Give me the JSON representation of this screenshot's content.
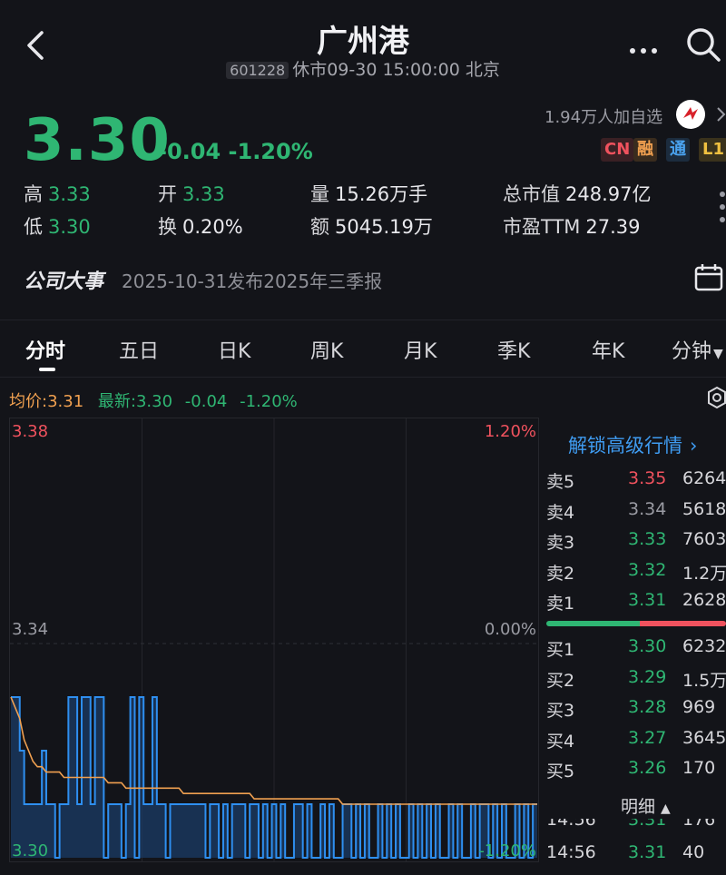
{
  "header": {
    "title": "广州港",
    "code": "601228",
    "status": "休市09-30 15:00:00 北京"
  },
  "quote": {
    "price": "3.30",
    "change": "-0.04 -1.20%",
    "watch_count": "1.94万人加自选",
    "badges": [
      "CN",
      "融",
      "通",
      "L1"
    ]
  },
  "stats": {
    "high_label": "高",
    "high": "3.33",
    "open_label": "开",
    "open": "3.33",
    "volume_label": "量",
    "volume": "15.26万手",
    "mcap_label": "总市值",
    "mcap": "248.97亿",
    "low_label": "低",
    "low": "3.30",
    "turnover_label": "换",
    "turnover": "0.20%",
    "amount_label": "额",
    "amount": "5045.19万",
    "pe_label": "市盈TTM",
    "pe": "27.39"
  },
  "event": {
    "label": "公司大事",
    "text": "2025-10-31发布2025年三季报"
  },
  "tabs": [
    "分时",
    "五日",
    "日K",
    "周K",
    "月K",
    "季K",
    "年K",
    "分钟"
  ],
  "chart_info": {
    "avg": "均价:3.31",
    "latest": "最新:3.30",
    "change": "-0.04",
    "pct": "-1.20%"
  },
  "chart_labels": {
    "y_top": "3.38",
    "y_mid": "3.34",
    "y_bot": "3.30",
    "pct_top": "1.20%",
    "pct_mid": "0.00%",
    "pct_bot": "-1.20%"
  },
  "chart_data": {
    "type": "line",
    "ylim": [
      3.3,
      3.38
    ],
    "series": [
      {
        "name": "价格",
        "color": "#2e8ff0",
        "values": [
          3.33,
          3.33,
          3.32,
          3.31,
          3.31,
          3.31,
          3.31,
          3.32,
          3.31,
          3.31,
          3.3,
          3.31,
          3.31,
          3.33,
          3.33,
          3.31,
          3.33,
          3.33,
          3.31,
          3.33,
          3.33,
          3.3,
          3.31,
          3.31,
          3.31,
          3.3,
          3.31,
          3.33,
          3.3,
          3.33,
          3.31,
          3.31,
          3.33,
          3.31,
          3.31,
          3.3,
          3.31,
          3.31,
          3.31,
          3.31,
          3.31,
          3.31,
          3.31,
          3.31,
          3.3,
          3.31,
          3.31,
          3.3,
          3.31,
          3.3,
          3.31,
          3.31,
          3.31,
          3.3,
          3.31,
          3.31,
          3.3,
          3.31,
          3.3,
          3.31,
          3.3,
          3.31,
          3.3,
          3.3,
          3.31,
          3.31,
          3.3,
          3.31,
          3.3,
          3.3,
          3.31,
          3.3,
          3.31,
          3.3,
          3.3,
          3.31,
          3.31,
          3.3,
          3.31,
          3.3,
          3.31,
          3.3,
          3.3,
          3.31,
          3.3,
          3.31,
          3.3,
          3.31,
          3.3,
          3.3,
          3.31,
          3.3,
          3.31,
          3.3,
          3.31,
          3.3,
          3.31,
          3.3,
          3.3,
          3.31,
          3.3,
          3.31,
          3.3,
          3.3,
          3.31,
          3.3,
          3.31,
          3.31,
          3.3,
          3.31,
          3.3,
          3.31,
          3.3,
          3.3,
          3.31,
          3.3,
          3.31,
          3.3,
          3.31,
          3.31
        ]
      },
      {
        "name": "均价",
        "color": "#f0a050",
        "values": [
          3.33,
          3.328,
          3.326,
          3.322,
          3.32,
          3.318,
          3.317,
          3.317,
          3.316,
          3.316,
          3.316,
          3.316,
          3.315,
          3.315,
          3.315,
          3.315,
          3.315,
          3.315,
          3.315,
          3.315,
          3.315,
          3.315,
          3.314,
          3.314,
          3.314,
          3.314,
          3.313,
          3.313,
          3.313,
          3.313,
          3.313,
          3.313,
          3.313,
          3.313,
          3.313,
          3.313,
          3.313,
          3.313,
          3.313,
          3.312,
          3.312,
          3.312,
          3.312,
          3.312,
          3.312,
          3.312,
          3.312,
          3.312,
          3.312,
          3.312,
          3.312,
          3.312,
          3.312,
          3.312,
          3.312,
          3.311,
          3.311,
          3.311,
          3.311,
          3.311,
          3.311,
          3.311,
          3.311,
          3.311,
          3.311,
          3.311,
          3.311,
          3.311,
          3.311,
          3.311,
          3.311,
          3.311,
          3.311,
          3.311,
          3.311,
          3.31,
          3.31,
          3.31,
          3.31,
          3.31,
          3.31,
          3.31,
          3.31,
          3.31,
          3.31,
          3.31,
          3.31,
          3.31,
          3.31,
          3.31,
          3.31,
          3.31,
          3.31,
          3.31,
          3.31,
          3.31,
          3.31,
          3.31,
          3.31,
          3.31,
          3.31,
          3.31,
          3.31,
          3.31,
          3.31,
          3.31,
          3.31,
          3.31,
          3.31,
          3.31,
          3.31,
          3.31,
          3.31,
          3.31,
          3.31,
          3.31,
          3.31,
          3.31,
          3.31,
          3.31
        ]
      }
    ]
  },
  "orderbook": {
    "unlock": "解锁高级行情",
    "asks": [
      {
        "label": "卖5",
        "price": "3.35",
        "vol": "6264",
        "color": "red"
      },
      {
        "label": "卖4",
        "price": "3.34",
        "vol": "5618",
        "color": "gray"
      },
      {
        "label": "卖3",
        "price": "3.33",
        "vol": "7603",
        "color": "green"
      },
      {
        "label": "卖2",
        "price": "3.32",
        "vol": "1.2万",
        "color": "green"
      },
      {
        "label": "卖1",
        "price": "3.31",
        "vol": "2628",
        "color": "green"
      }
    ],
    "bids": [
      {
        "label": "买1",
        "price": "3.30",
        "vol": "6232",
        "color": "green"
      },
      {
        "label": "买2",
        "price": "3.29",
        "vol": "1.5万",
        "color": "green"
      },
      {
        "label": "买3",
        "price": "3.28",
        "vol": "969",
        "color": "green"
      },
      {
        "label": "买4",
        "price": "3.27",
        "vol": "3645",
        "color": "green"
      },
      {
        "label": "买5",
        "price": "3.26",
        "vol": "170",
        "color": "green"
      }
    ],
    "detail_label": "明细",
    "ticks": [
      {
        "time": "14:56",
        "price": "3.31",
        "vol": "176"
      },
      {
        "time": "14:56",
        "price": "3.31",
        "vol": "40"
      }
    ]
  }
}
